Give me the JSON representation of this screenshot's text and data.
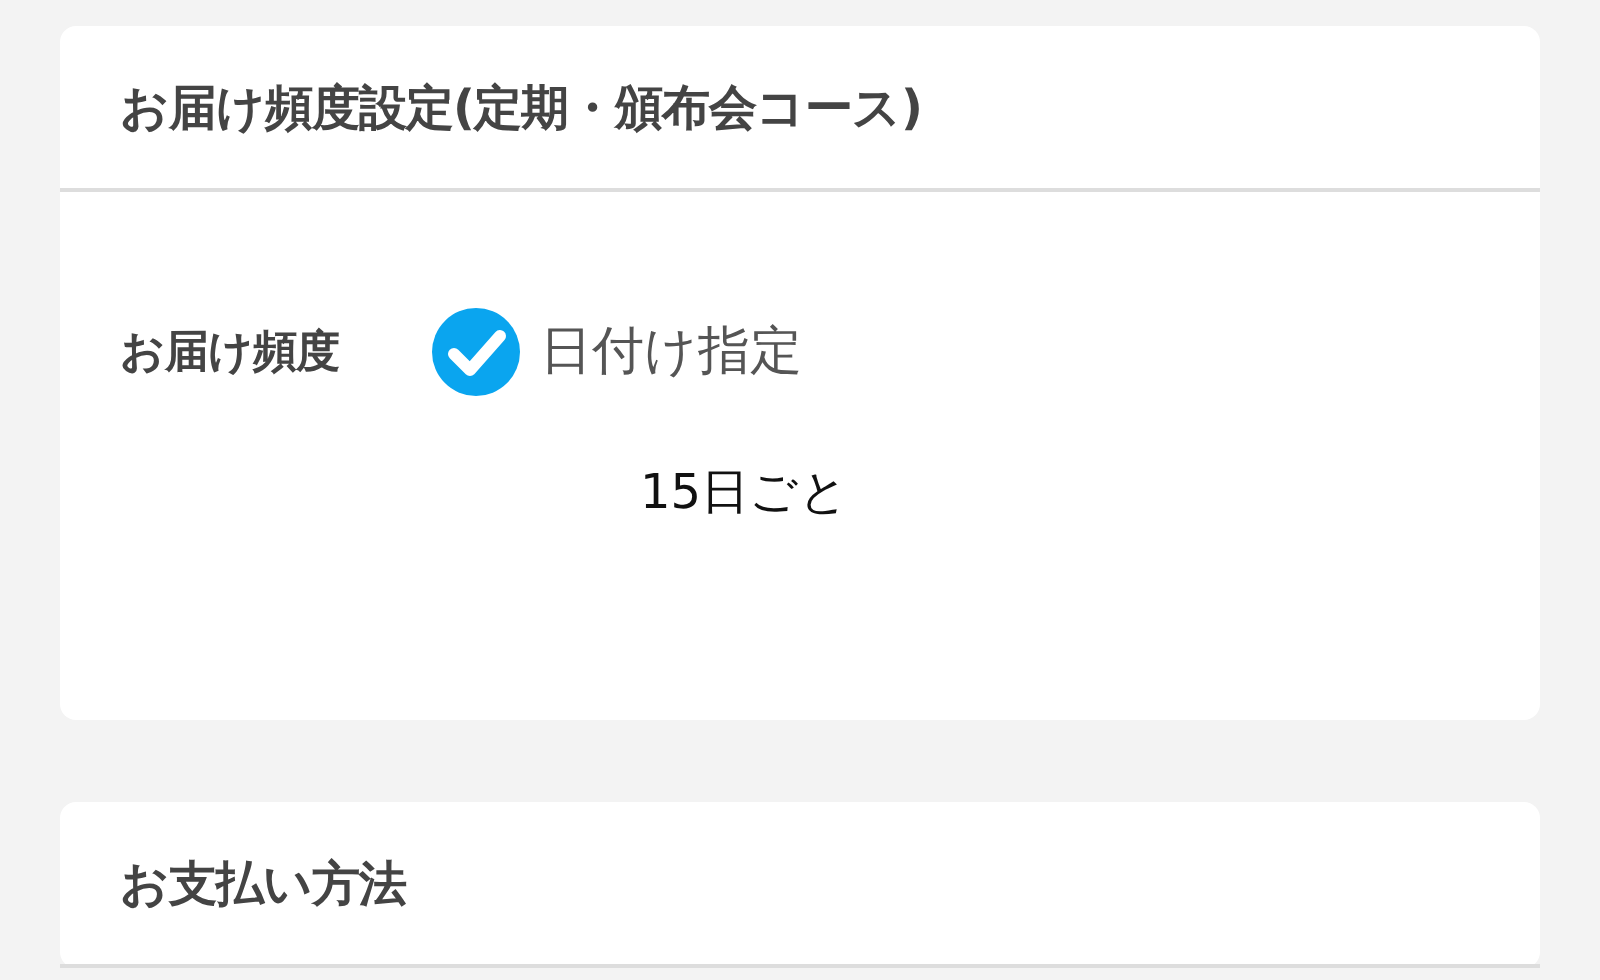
{
  "sections": [
    {
      "title": "お届け頻度設定(定期・頒布会コース)",
      "frequency": {
        "label": "お届け頻度",
        "option": {
          "label": "日付け指定",
          "checked": true
        },
        "value": "15日ごと"
      }
    },
    {
      "title": "お支払い方法"
    }
  ]
}
